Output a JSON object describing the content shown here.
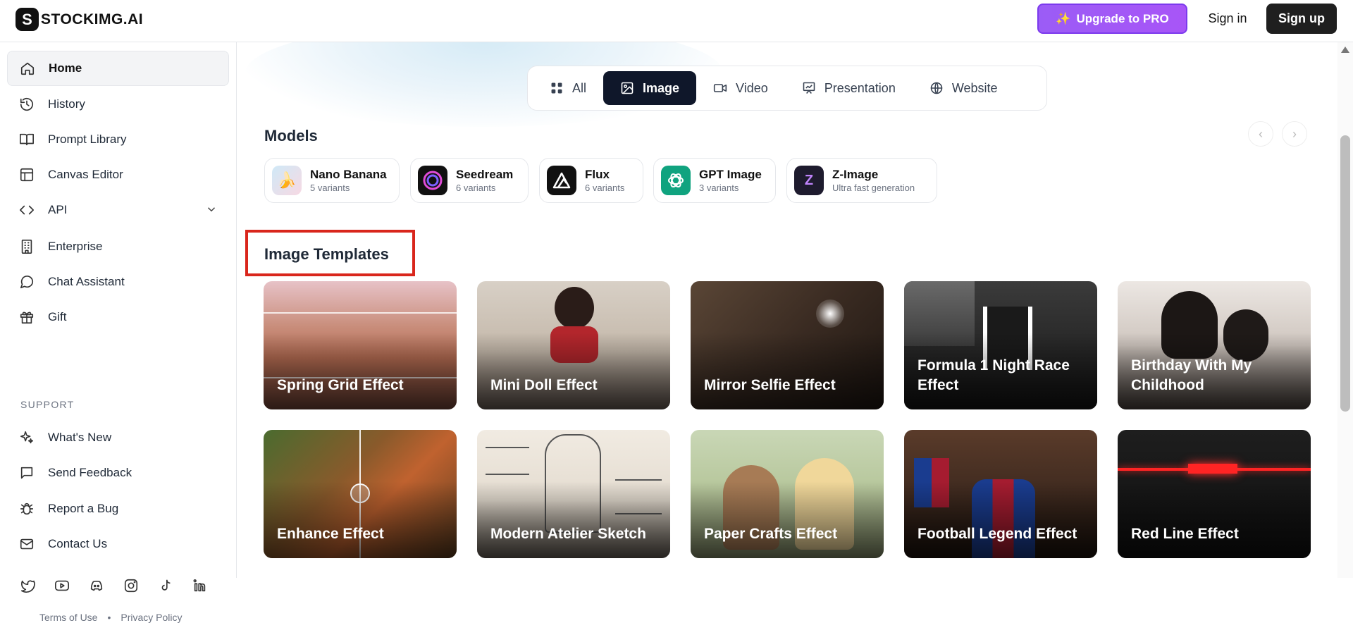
{
  "brand": {
    "logo_letter": "S",
    "name": "STOCKIMG.AI"
  },
  "header": {
    "upgrade_icon": "✨",
    "upgrade_label": "Upgrade to PRO",
    "signin_label": "Sign in",
    "signup_label": "Sign up"
  },
  "sidebar": {
    "items": [
      {
        "label": "Home",
        "icon": "home-icon"
      },
      {
        "label": "History",
        "icon": "history-icon"
      },
      {
        "label": "Prompt Library",
        "icon": "book-icon"
      },
      {
        "label": "Canvas Editor",
        "icon": "layout-icon"
      },
      {
        "label": "API",
        "icon": "code-icon"
      },
      {
        "label": "Enterprise",
        "icon": "building-icon"
      },
      {
        "label": "Chat Assistant",
        "icon": "chat-icon"
      },
      {
        "label": "Gift",
        "icon": "gift-icon"
      }
    ],
    "support_label": "SUPPORT",
    "support_items": [
      {
        "label": "What's New",
        "icon": "sparkles-icon"
      },
      {
        "label": "Send Feedback",
        "icon": "message-icon"
      },
      {
        "label": "Report a Bug",
        "icon": "bug-icon"
      },
      {
        "label": "Contact Us",
        "icon": "mail-icon"
      }
    ],
    "footer_links": [
      "Terms of Use",
      "•",
      "Privacy Policy"
    ]
  },
  "tabs": [
    {
      "label": "All",
      "icon": "grid-icon"
    },
    {
      "label": "Image",
      "icon": "image-icon"
    },
    {
      "label": "Video",
      "icon": "video-icon"
    },
    {
      "label": "Presentation",
      "icon": "presentation-icon"
    },
    {
      "label": "Website",
      "icon": "globe-icon"
    }
  ],
  "models": {
    "title": "Models",
    "prev_glyph": "‹",
    "next_glyph": "›",
    "items": [
      {
        "name": "Nano Banana",
        "sub": "5 variants",
        "glyph": "🍌"
      },
      {
        "name": "Seedream",
        "sub": "6 variants",
        "glyph": ""
      },
      {
        "name": "Flux",
        "sub": "6 variants",
        "glyph": ""
      },
      {
        "name": "GPT Image",
        "sub": "3 variants",
        "glyph": ""
      },
      {
        "name": "Z-Image",
        "sub": "Ultra fast generation",
        "glyph": "Z"
      }
    ]
  },
  "templates": {
    "title": "Image Templates",
    "cards": [
      {
        "label": "Spring Grid Effect"
      },
      {
        "label": "Mini Doll Effect"
      },
      {
        "label": "Mirror Selfie Effect"
      },
      {
        "label": "Formula 1 Night Race Effect"
      },
      {
        "label": "Birthday With My Childhood"
      },
      {
        "label": "Enhance Effect"
      },
      {
        "label": "Modern Atelier Sketch"
      },
      {
        "label": "Paper Crafts Effect"
      },
      {
        "label": "Football Legend Effect"
      },
      {
        "label": "Red Line Effect"
      }
    ]
  },
  "colors": {
    "accent": "#a855f7",
    "active_tab": "#0f172a",
    "highlight_box": "#d9261c"
  }
}
